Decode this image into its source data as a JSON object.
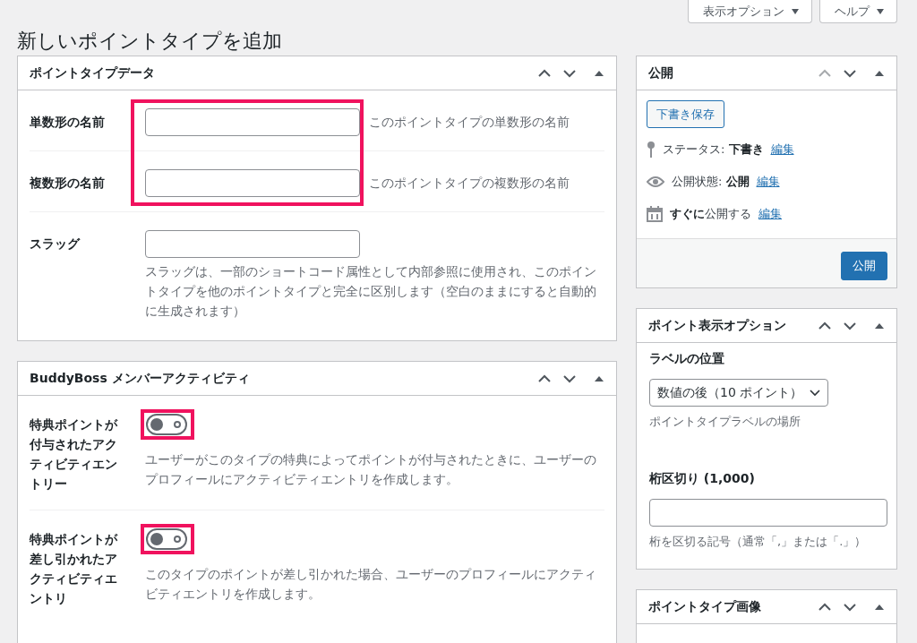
{
  "header_buttons": [
    {
      "label": "表示オプション"
    },
    {
      "label": "ヘルプ"
    }
  ],
  "page_title": "新しいポイントタイプを追加",
  "main_panels": [
    {
      "title": "ポイントタイプデータ",
      "up_disabled": false,
      "kind": "fields",
      "rows": [
        {
          "label": "単数形の名前",
          "description": "このポイントタイプの単数形の名前",
          "highlighted": true
        },
        {
          "label": "複数形の名前",
          "description": "このポイントタイプの複数形の名前",
          "highlighted": true
        },
        {
          "label": "スラッグ",
          "description": "スラッグは、一部のショートコード属性として内部参照に使用され、このポイントタイプを他のポイントタイプと完全に区別します（空白のままにすると自動的に生成されます）"
        }
      ]
    },
    {
      "title": "BuddyBoss メンバーアクティビティ",
      "up_disabled": false,
      "kind": "toggles",
      "rows": [
        {
          "label": "特典ポイントが付与されたアクティビティエントリー",
          "on": false,
          "description": "ユーザーがこのタイプの特典によってポイントが付与されたときに、ユーザーのプロフィールにアクティビティエントリを作成します。",
          "highlighted": true
        },
        {
          "label": "特典ポイントが差し引かれたアクティビティエントリ",
          "on": false,
          "description": "このタイプのポイントが差し引かれた場合、ユーザーのプロフィールにアクティビティエントリを作成します。",
          "highlighted": true
        }
      ]
    }
  ],
  "side_panels": [
    {
      "title": "公開",
      "up_disabled": true,
      "kind": "publish",
      "save_draft": "下書き保存",
      "meta": [
        {
          "kind": "pin",
          "text": "ステータス: **下書き**",
          "link": "編集"
        },
        {
          "kind": "eye",
          "text": "公開状態: **公開**",
          "link": "編集"
        },
        {
          "kind": "calendar",
          "text": "**すぐに**公開する",
          "link": "編集"
        }
      ],
      "publish_button": "公開"
    },
    {
      "title": "ポイント表示オプション",
      "up_disabled": false,
      "kind": "form",
      "items": [
        {
          "kind": "select",
          "label": "ラベルの位置",
          "value": "数値の後（10 ポイント）",
          "hint": "ポイントタイプラベルの場所"
        },
        {
          "kind": "input",
          "label": "桁区切り (1,000)",
          "hint": "桁を区切る記号（通常「,」または「.」）"
        }
      ]
    },
    {
      "title": "ポイントタイプ画像",
      "up_disabled": false,
      "kind": "empty"
    }
  ]
}
